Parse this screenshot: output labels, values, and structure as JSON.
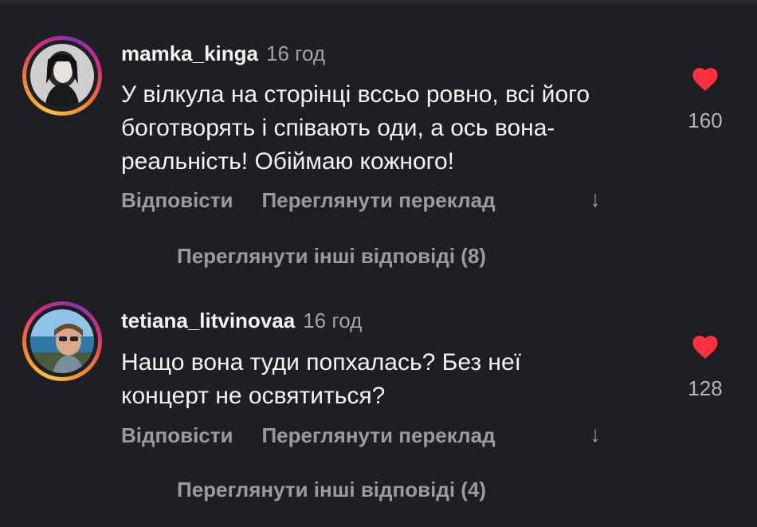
{
  "comments": [
    {
      "username": "mamka_kinga",
      "time": "16 год",
      "text": "У вілкула на сторінці вссьо ровно, всі його боготворять і співають оди, а ось вона- реальність! Обіймаю кожного!",
      "likes": "160",
      "reply_label": "Відповісти",
      "translate_label": "Переглянути переклад",
      "more_replies": "Переглянути інші відповіді (8)"
    },
    {
      "username": "tetiana_litvinovaa",
      "time": "16 год",
      "text": "Нащо вона туди попхалась? Без неї концерт не освятиться?",
      "likes": "128",
      "reply_label": "Відповісти",
      "translate_label": "Переглянути переклад",
      "more_replies": "Переглянути інші відповіді (4)"
    }
  ],
  "colors": {
    "background": "#1e1f23",
    "heart": "#ff3040",
    "muted": "#9a9aa0"
  },
  "icons": {
    "like": "heart-icon",
    "expand": "arrow-down-icon"
  }
}
